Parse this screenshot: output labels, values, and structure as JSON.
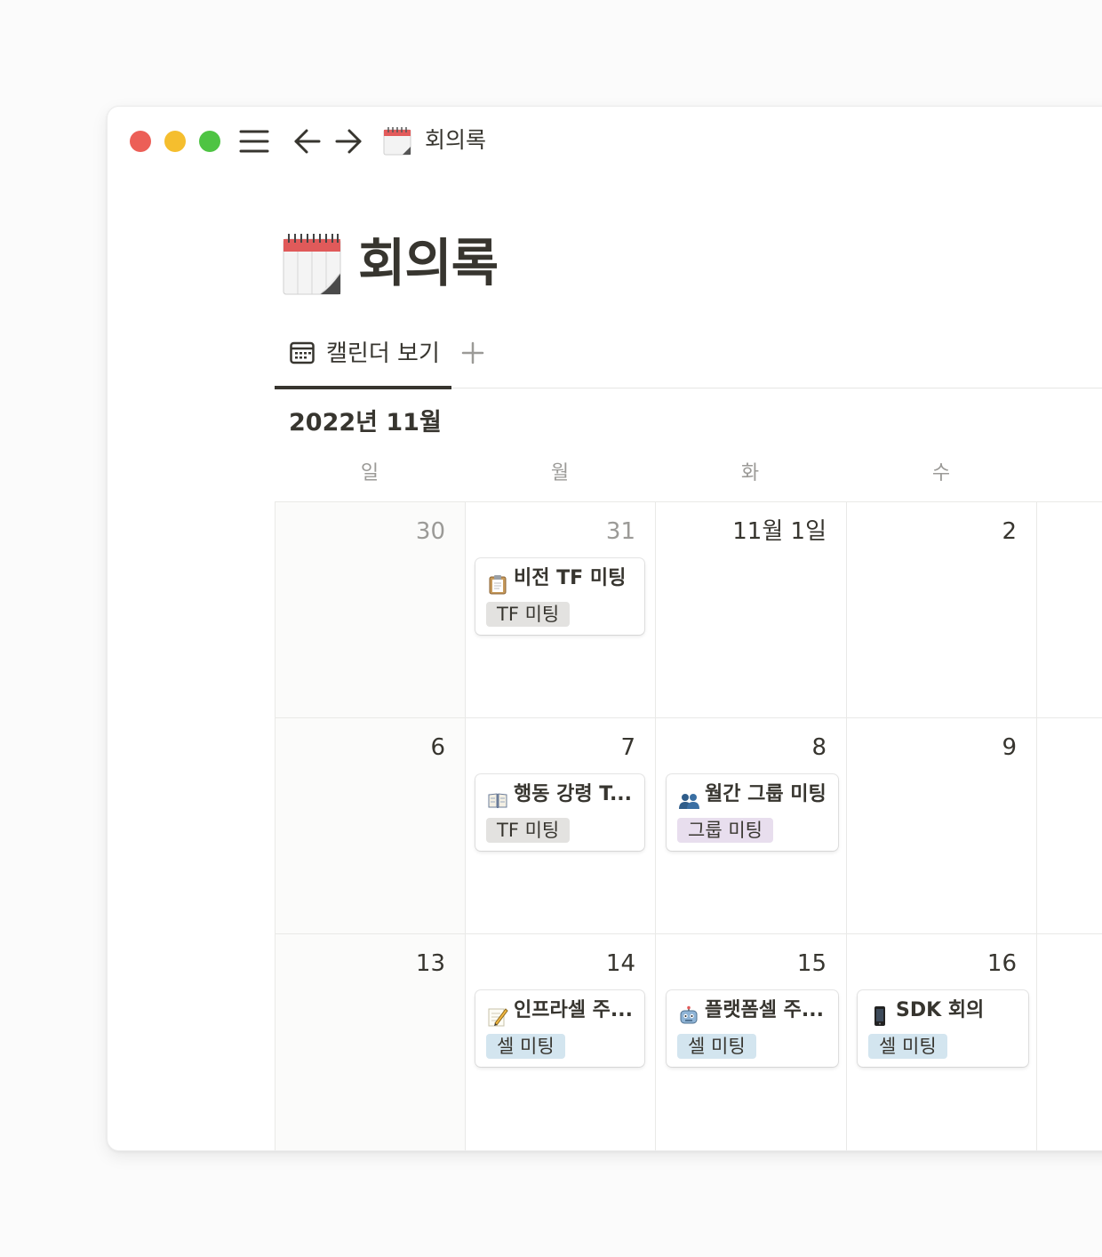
{
  "topbar": {
    "page_title": "회의록",
    "icons": [
      "menu-icon",
      "arrow-left-icon",
      "arrow-right-icon",
      "calendar-page-icon"
    ]
  },
  "page": {
    "title": "회의록",
    "icon": "spiral-calendar-icon"
  },
  "views": {
    "tabs": [
      {
        "label": "캘린더 보기",
        "icon": "calendar-icon",
        "active": true
      }
    ],
    "add_icon": "plus-icon"
  },
  "calendar": {
    "month_label": "2022년 11월",
    "weekdays": [
      "일",
      "월",
      "화",
      "수"
    ],
    "weeks": [
      {
        "days": [
          {
            "label": "30",
            "dim": true
          },
          {
            "label": "31",
            "dim": true,
            "events": [
              {
                "icon": "clipboard-icon",
                "title": "비전 TF 미팅",
                "tag": "TF 미팅",
                "tag_color": "#e3e2e0"
              }
            ]
          },
          {
            "label": "11월 1일"
          },
          {
            "label": "2"
          }
        ]
      },
      {
        "days": [
          {
            "label": "6"
          },
          {
            "label": "7",
            "events": [
              {
                "icon": "open-book-icon",
                "title": "행동 강령 T...",
                "tag": "TF 미팅",
                "tag_color": "#e3e2e0"
              }
            ]
          },
          {
            "label": "8",
            "events": [
              {
                "icon": "people-icon",
                "title": "월간 그룹 미팅",
                "tag": "그룹 미팅",
                "tag_color": "#e8deee"
              }
            ]
          },
          {
            "label": "9"
          }
        ]
      },
      {
        "days": [
          {
            "label": "13"
          },
          {
            "label": "14",
            "events": [
              {
                "icon": "memo-icon",
                "title": "인프라셀 주...",
                "tag": "셀 미팅",
                "tag_color": "#d3e5ef"
              }
            ]
          },
          {
            "label": "15",
            "events": [
              {
                "icon": "robot-icon",
                "title": "플랫폼셀 주...",
                "tag": "셀 미팅",
                "tag_color": "#d3e5ef"
              }
            ]
          },
          {
            "label": "16",
            "events": [
              {
                "icon": "mobile-phone-icon",
                "title": "SDK 회의",
                "tag": "셀 미팅",
                "tag_color": "#d3e5ef"
              }
            ]
          }
        ]
      }
    ]
  }
}
